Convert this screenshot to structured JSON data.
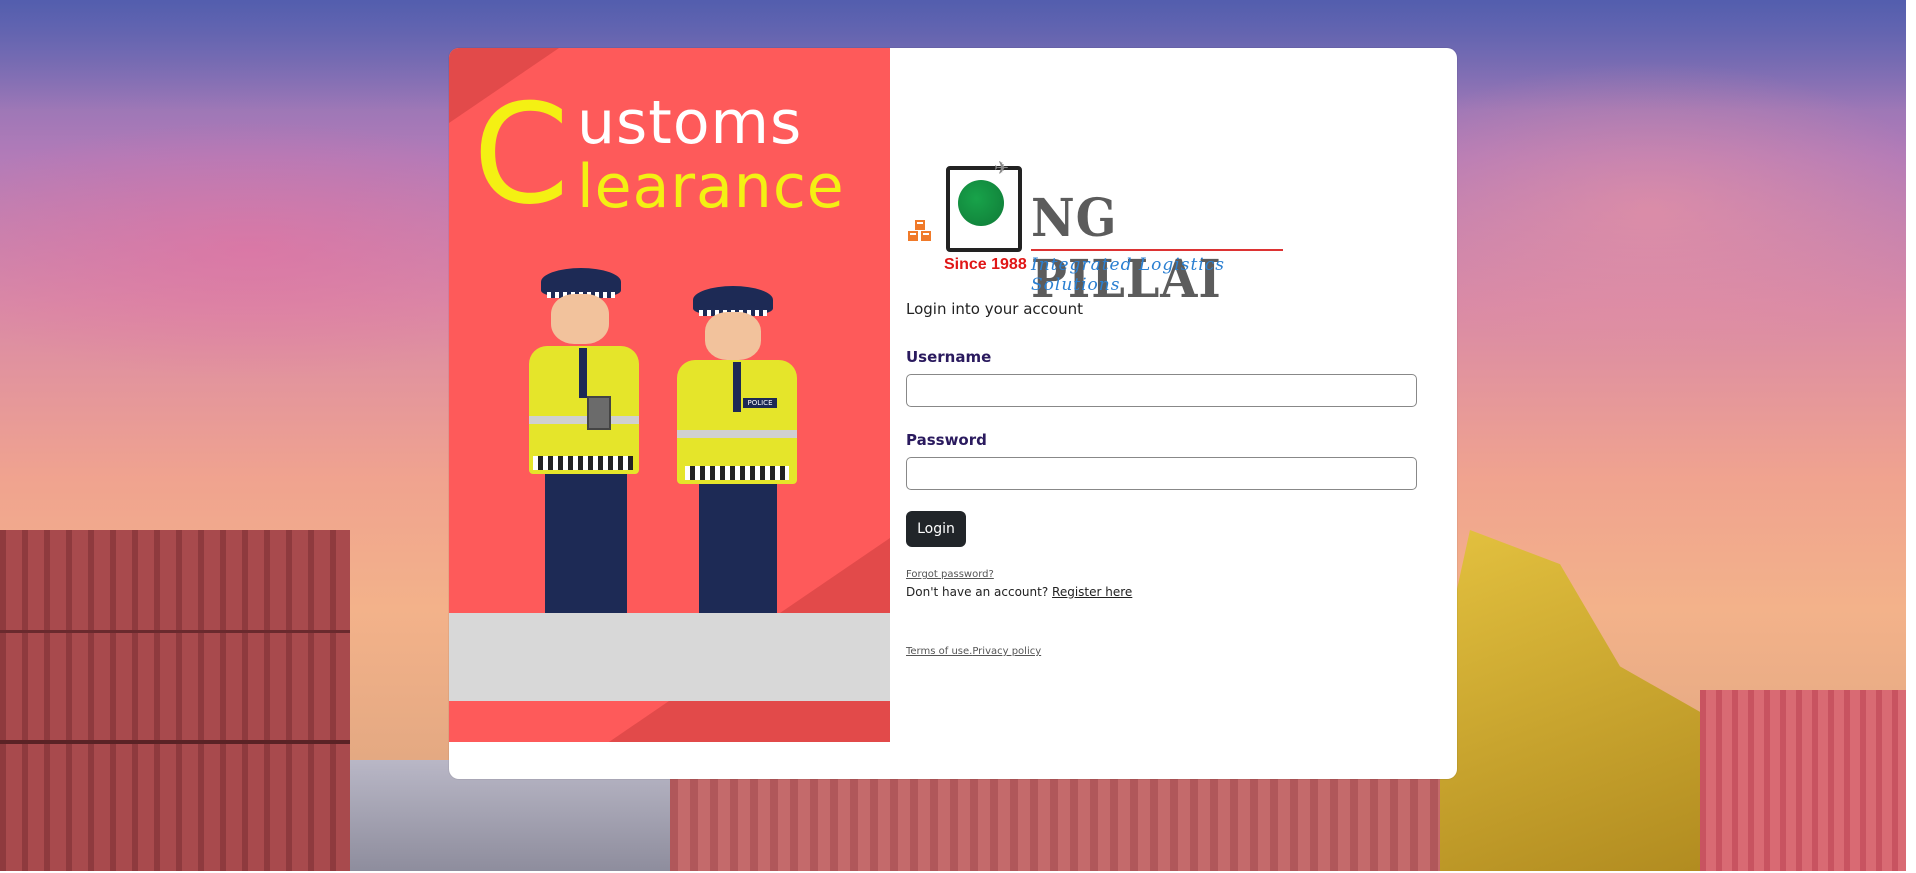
{
  "promo": {
    "headline_initial": "C",
    "headline_word1": "ustoms",
    "headline_word2": "learance",
    "badge_text": "POLICE"
  },
  "logo": {
    "brand": "NG PILLAI",
    "since": "Since 1988",
    "tagline": "Integrated Logistics Solutions"
  },
  "form": {
    "subtitle": "Login into your account",
    "username_label": "Username",
    "username_value": "",
    "password_label": "Password",
    "password_value": "",
    "login_label": "Login",
    "forgot_label": "Forgot password?",
    "no_account_text": "Don't have an account?",
    "register_label": "Register here",
    "terms_label": "Terms of use.",
    "privacy_label": "Privacy policy"
  },
  "colors": {
    "promo_bg": "#fe5a5a",
    "promo_accent": "#f4f013",
    "button_bg": "#212529",
    "label_color": "#2a1a5e"
  }
}
